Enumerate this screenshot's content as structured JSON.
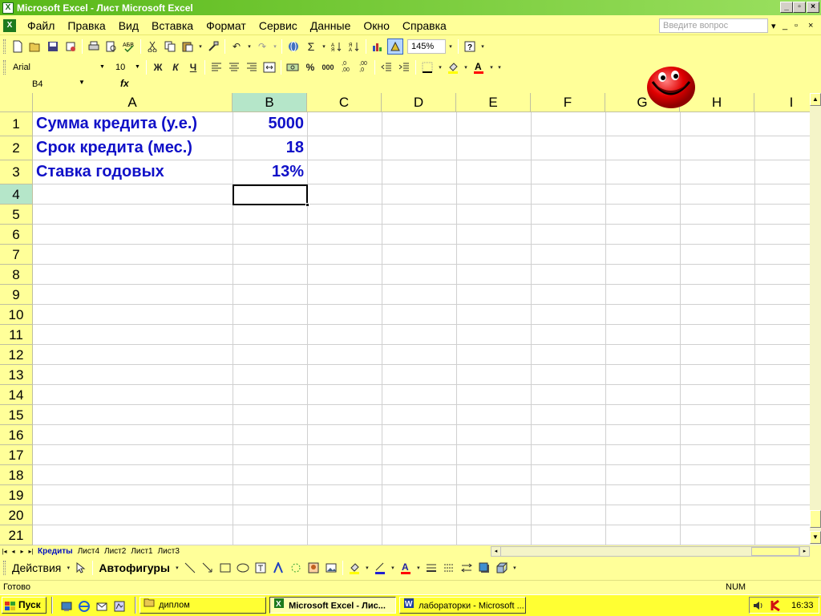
{
  "window": {
    "title": "Microsoft Excel - Лист Microsoft Excel"
  },
  "menu": {
    "items": [
      "Файл",
      "Правка",
      "Вид",
      "Вставка",
      "Формат",
      "Сервис",
      "Данные",
      "Окно",
      "Справка"
    ],
    "ask_placeholder": "Введите вопрос"
  },
  "toolbar": {
    "zoom": "145%"
  },
  "format_toolbar": {
    "font": "Arial",
    "size": "10",
    "bold": "Ж",
    "italic": "К",
    "underline": "Ч",
    "thousands": "000",
    "percent": "%"
  },
  "formula_bar": {
    "name_box": "B4",
    "fx": "fx"
  },
  "columns": [
    "A",
    "B",
    "C",
    "D",
    "E",
    "F",
    "G",
    "H",
    "I"
  ],
  "rows": [
    "1",
    "2",
    "3",
    "4",
    "5",
    "6",
    "7",
    "8",
    "9",
    "10",
    "11",
    "12",
    "13",
    "14",
    "15",
    "16",
    "17",
    "18",
    "19",
    "20",
    "21"
  ],
  "cells": {
    "A1": "Сумма кредита (у.е.)",
    "B1": "5000",
    "A2": "Срок кредита (мес.)",
    "B2": "18",
    "A3": "Ставка годовых",
    "B3": "13%"
  },
  "sheet_tabs": [
    "Кредиты",
    "Лист4",
    "Лист2",
    "Лист1",
    "Лист3"
  ],
  "draw_toolbar": {
    "actions": "Действия",
    "autoshapes": "Автофигуры"
  },
  "status": {
    "left": "Готово",
    "num": "NUM"
  },
  "taskbar": {
    "start": "Пуск",
    "buttons": [
      "диплом",
      "Microsoft Excel - Лис...",
      "лабораторки - Microsoft ..."
    ],
    "clock": "16:33"
  }
}
